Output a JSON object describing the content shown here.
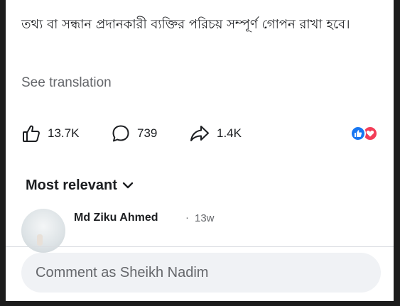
{
  "post": {
    "text": "তথ্য বা সন্ধান প্রদানকারী ব্যক্তির পরিচয় সম্পূর্ণ গোপন রাখা হবে।",
    "see_translation": "See translation"
  },
  "actions": {
    "likes": "13.7K",
    "comments": "739",
    "shares": "1.4K"
  },
  "reactions": [
    "like-icon",
    "love-icon"
  ],
  "comments_section": {
    "sort_label": "Most relevant",
    "first_comment": {
      "author": "Md Ziku Ahmed",
      "separator": "·",
      "time": "13w"
    }
  },
  "composer": {
    "placeholder": "Comment as Sheikh Nadim"
  },
  "colors": {
    "like_blue": "#1877f2",
    "love_red": "#f33e58",
    "secondary_text": "#65676b",
    "input_bg": "#f0f2f5"
  }
}
